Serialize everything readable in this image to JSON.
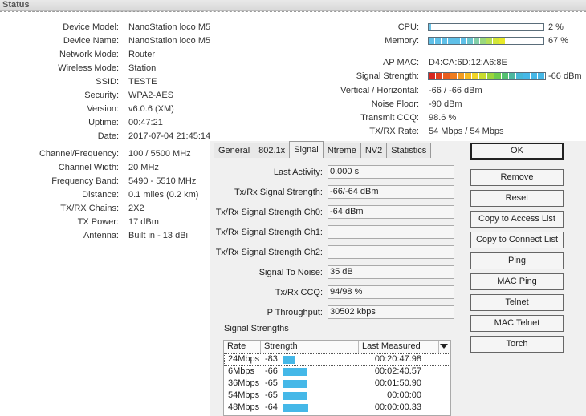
{
  "header": {
    "title": "Status"
  },
  "left_info": [
    {
      "label": "Device Model:",
      "value": "NanoStation loco M5"
    },
    {
      "label": "Device Name:",
      "value": "NanoStation loco M5"
    },
    {
      "label": "Network Mode:",
      "value": "Router"
    },
    {
      "label": "Wireless Mode:",
      "value": "Station"
    },
    {
      "label": "SSID:",
      "value": "TESTE"
    },
    {
      "label": "Security:",
      "value": "WPA2-AES"
    },
    {
      "label": "Version:",
      "value": "v6.0.6 (XM)"
    },
    {
      "label": "Uptime:",
      "value": "00:47:21"
    },
    {
      "label": "Date:",
      "value": "2017-07-04 21:45:14"
    }
  ],
  "left_info2": [
    {
      "label": "Channel/Frequency:",
      "value": "100 / 5500 MHz"
    },
    {
      "label": "Channel Width:",
      "value": "20 MHz"
    },
    {
      "label": "Frequency Band:",
      "value": "5490 - 5510 MHz"
    },
    {
      "label": "Distance:",
      "value": "0.1 miles (0.2 km)"
    },
    {
      "label": "TX/RX Chains:",
      "value": "2X2"
    },
    {
      "label": "TX Power:",
      "value": "17 dBm"
    },
    {
      "label": "Antenna:",
      "value": "Built in - 13 dBi"
    }
  ],
  "right_info": {
    "cpu": {
      "label": "CPU:",
      "value": "2 %",
      "percent": 2
    },
    "memory": {
      "label": "Memory:",
      "value": "67 %",
      "percent": 67
    },
    "ap_mac": {
      "label": "AP MAC:",
      "value": "D4:CA:6D:12:A6:8E"
    },
    "signal": {
      "label": "Signal Strength:",
      "value": "-66 dBm",
      "percent": 100
    },
    "rows": [
      {
        "label": "Vertical / Horizontal:",
        "value": "-66 / -66 dBm"
      },
      {
        "label": "Noise Floor:",
        "value": "-90 dBm"
      },
      {
        "label": "Transmit CCQ:",
        "value": "98.6 %"
      },
      {
        "label": "TX/RX Rate:",
        "value": "54 Mbps / 54 Mbps"
      }
    ]
  },
  "tabs": [
    "General",
    "802.1x",
    "Signal",
    "Ntreme",
    "NV2",
    "Statistics"
  ],
  "active_tab": "Signal",
  "fields": [
    {
      "label": "Last Activity:",
      "value": "0.000 s"
    },
    {
      "label": "Tx/Rx Signal Strength:",
      "value": "-66/-64 dBm"
    },
    {
      "label": "Tx/Rx Signal Strength Ch0:",
      "value": "-64 dBm"
    },
    {
      "label": "Tx/Rx Signal Strength Ch1:",
      "value": ""
    },
    {
      "label": "Tx/Rx Signal Strength Ch2:",
      "value": ""
    },
    {
      "label": "Signal To Noise:",
      "value": "35 dB"
    },
    {
      "label": "Tx/Rx CCQ:",
      "value": "94/98 %"
    },
    {
      "label": "P Throughput:",
      "value": "30502 kbps"
    }
  ],
  "buttons": [
    "OK",
    "Remove",
    "Reset",
    "Copy to Access List",
    "Copy to Connect List",
    "Ping",
    "MAC Ping",
    "Telnet",
    "MAC Telnet",
    "Torch"
  ],
  "signal_group": {
    "title": "Signal Strengths",
    "columns": [
      "Rate",
      "Strength",
      "Last Measured"
    ],
    "rows": [
      {
        "rate": "24Mbps",
        "strength": "-83",
        "level": 0.3,
        "last": "00:20:47.98"
      },
      {
        "rate": "6Mbps",
        "strength": "-66",
        "level": 0.6,
        "last": "00:02:40.57"
      },
      {
        "rate": "36Mbps",
        "strength": "-65",
        "level": 0.62,
        "last": "00:01:50.90"
      },
      {
        "rate": "54Mbps",
        "strength": "-65",
        "level": 0.62,
        "last": "00:00:00"
      },
      {
        "rate": "48Mbps",
        "strength": "-64",
        "level": 0.64,
        "last": "00:00:00.33"
      }
    ]
  },
  "colors": {
    "bar_blue": "#45b8e8",
    "meter_border": "#5a6d7a"
  }
}
